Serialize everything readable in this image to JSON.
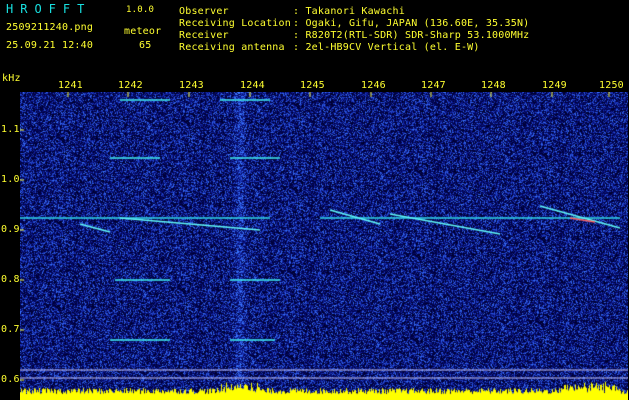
{
  "header": {
    "app_name": "HROFFT",
    "version": "1.0.0",
    "filename": "2509211240.png",
    "datetime": "25.09.21 12:40",
    "type_label": "meteor",
    "count": "65",
    "observer_label": "Observer",
    "observer_value": ": Takanori Kawachi",
    "location_label": "Receiving Location",
    "location_value": ": Ogaki, Gifu, JAPAN (136.60E, 35.35N)",
    "receiver_label": "Receiver",
    "receiver_value": ": R820T2(RTL-SDR) SDR-Sharp 53.1000MHz",
    "antenna_label": "Receiving antenna",
    "antenna_value": ": 2el-HB9CV Vertical (el. E-W)"
  },
  "axes": {
    "unit_label": "kHz",
    "x_ticks": [
      "1241",
      "1242",
      "1243",
      "1244",
      "1245",
      "1246",
      "1247",
      "1248",
      "1249",
      "1250"
    ],
    "y_ticks": [
      "1.1",
      "1.0",
      "0.9",
      "0.8",
      "0.7",
      "0.6"
    ]
  },
  "colors": {
    "background": "#000000",
    "header_text": "#18e0e0",
    "axis_text": "#ffff30",
    "noise": "#1a2cc8",
    "signal": "#40f0f0",
    "level_bar": "#ffff00"
  }
}
